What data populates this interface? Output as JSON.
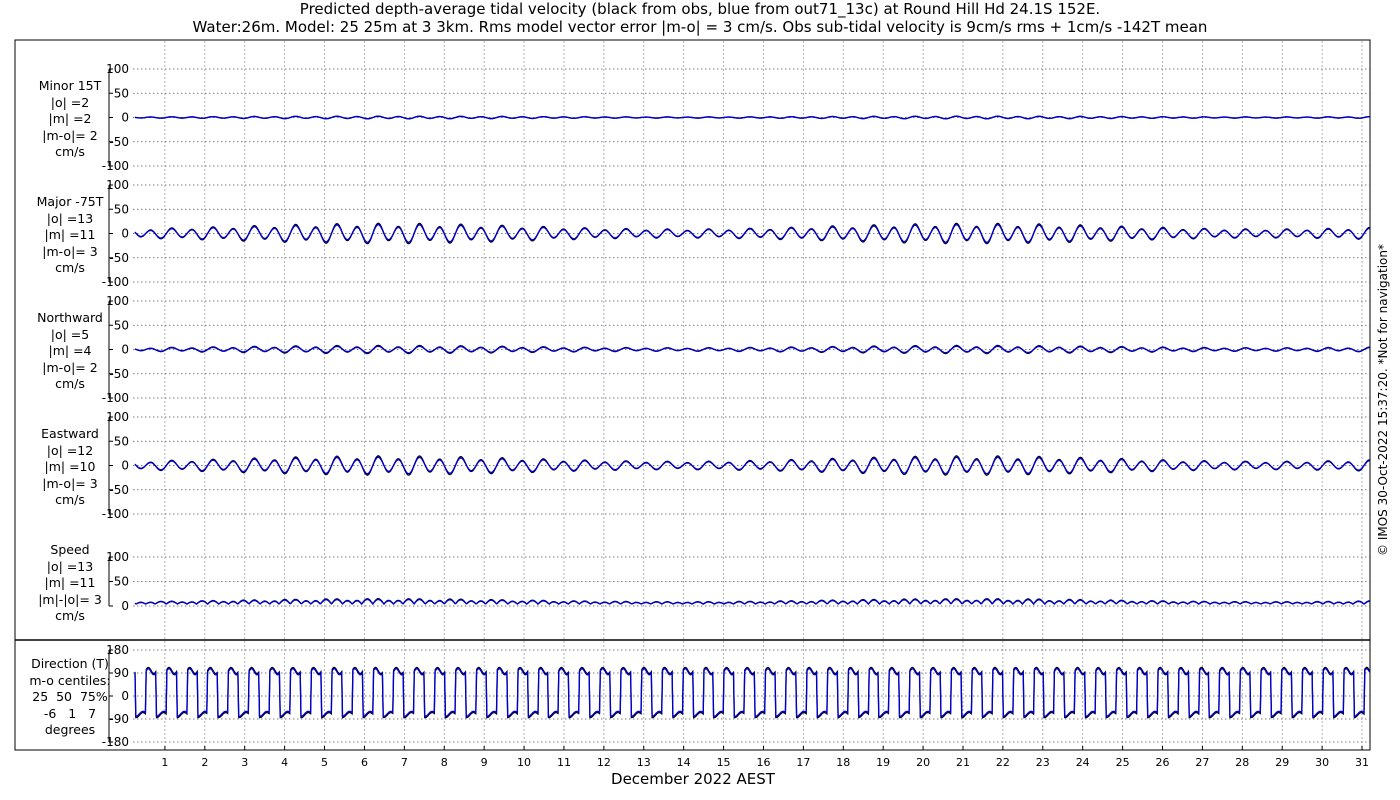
{
  "title_line1": "Predicted depth-average tidal velocity (black from obs, blue from out71_13c) at Round Hill Hd 24.1S 152E.",
  "title_line2": "Water:26m. Model: 25 25m at 3 3km. Rms model vector error |m-o| = 3 cm/s. Obs sub-tidal velocity is 9cm/s rms + 1cm/s -142T mean",
  "stamp": "© IMOS 30-Oct-2022 15:37:20. *Not for navigation*",
  "colors": {
    "obs": "#000000",
    "model": "#0000cc",
    "grid": "#9aa0b4"
  },
  "chart_data": [
    {
      "type": "line",
      "panel": "minor",
      "label_lines": [
        "Minor 15T",
        "|o| =2",
        "|m| =2",
        "|m-o|= 2",
        "cm/s"
      ],
      "ylim": [
        -100,
        100
      ],
      "yticks": [
        -100,
        -50,
        0,
        50,
        100
      ],
      "ytick_labels": [
        "-100",
        "-50",
        "0",
        "50",
        "100"
      ],
      "xlim": [
        0.2,
        31.2
      ],
      "grid": "dotted",
      "series": [
        {
          "role": "obs",
          "kind": "tidal",
          "amplitude": 2.5,
          "diurnal": 0.2,
          "offset": 0
        },
        {
          "role": "model",
          "kind": "tidal",
          "amplitude": 2.2,
          "diurnal": 0.2,
          "offset": 0
        }
      ]
    },
    {
      "type": "line",
      "panel": "major",
      "label_lines": [
        "Major -75T",
        "|o| =13",
        "|m| =11",
        "|m-o|= 3",
        "cm/s"
      ],
      "ylim": [
        -100,
        100
      ],
      "yticks": [
        -100,
        -50,
        0,
        50,
        100
      ],
      "ytick_labels": [
        "-100",
        "-50",
        "0",
        "50",
        "100"
      ],
      "xlim": [
        0.2,
        31.2
      ],
      "grid": "dotted",
      "series": [
        {
          "role": "obs",
          "kind": "tidal",
          "amplitude": 18,
          "diurnal": 0.25,
          "offset": 0
        },
        {
          "role": "model",
          "kind": "tidal",
          "amplitude": 15.5,
          "diurnal": 0.25,
          "offset": 0
        }
      ]
    },
    {
      "type": "line",
      "panel": "northward",
      "label_lines": [
        "Northward",
        "|o| =5",
        "|m| =4",
        "|m-o|= 2",
        "cm/s"
      ],
      "ylim": [
        -100,
        100
      ],
      "yticks": [
        -100,
        -50,
        0,
        50,
        100
      ],
      "ytick_labels": [
        "-100",
        "-50",
        "0",
        "50",
        "100"
      ],
      "xlim": [
        0.2,
        31.2
      ],
      "grid": "dotted",
      "series": [
        {
          "role": "obs",
          "kind": "tidal",
          "amplitude": 7,
          "diurnal": 0.3,
          "offset": 0
        },
        {
          "role": "model",
          "kind": "tidal",
          "amplitude": 5.5,
          "diurnal": 0.3,
          "offset": 0
        }
      ]
    },
    {
      "type": "line",
      "panel": "eastward",
      "label_lines": [
        "Eastward",
        "|o| =12",
        "|m| =10",
        "|m-o|= 3",
        "cm/s"
      ],
      "ylim": [
        -100,
        100
      ],
      "yticks": [
        -100,
        -50,
        0,
        50,
        100
      ],
      "ytick_labels": [
        "-100",
        "-50",
        "0",
        "50",
        "100"
      ],
      "xlim": [
        0.2,
        31.2
      ],
      "grid": "dotted",
      "series": [
        {
          "role": "obs",
          "kind": "tidal",
          "amplitude": 17,
          "diurnal": 0.25,
          "offset": 0
        },
        {
          "role": "model",
          "kind": "tidal",
          "amplitude": 14.5,
          "diurnal": 0.25,
          "offset": 0
        }
      ]
    },
    {
      "type": "line",
      "panel": "speed",
      "label_lines": [
        "Speed",
        "|o| =13",
        "|m| =11",
        "|m|-|o|= 3",
        "cm/s"
      ],
      "ylim": [
        0,
        100
      ],
      "yticks": [
        0,
        50,
        100
      ],
      "ytick_labels": [
        "0",
        "50",
        "100"
      ],
      "xlim": [
        0.2,
        31.2
      ],
      "grid": "dotted",
      "series": [
        {
          "role": "obs",
          "kind": "speed",
          "amplitude": 17,
          "diurnal": 0.25,
          "offset": 0
        },
        {
          "role": "model",
          "kind": "speed",
          "amplitude": 14.5,
          "diurnal": 0.25,
          "offset": 0
        }
      ]
    },
    {
      "type": "line",
      "panel": "direction",
      "label_lines": [
        "Direction (T)",
        "m-o centiles:",
        "25  50  75%",
        "-6   1   7",
        "degrees"
      ],
      "ylim": [
        -180,
        180
      ],
      "yticks": [
        -180,
        -90,
        0,
        90,
        180
      ],
      "ytick_labels": [
        "-180",
        "-90",
        "0",
        "90",
        "180"
      ],
      "xlim": [
        0.2,
        31.2
      ],
      "grid": "dotted",
      "series": [
        {
          "role": "obs",
          "kind": "direction",
          "high": 100,
          "low": -75
        },
        {
          "role": "model",
          "kind": "direction",
          "high": 95,
          "low": -70
        }
      ]
    }
  ],
  "xaxis": {
    "label": "December 2022 AEST",
    "ticks": [
      1,
      2,
      3,
      4,
      5,
      6,
      7,
      8,
      9,
      10,
      11,
      12,
      13,
      14,
      15,
      16,
      17,
      18,
      19,
      20,
      21,
      22,
      23,
      24,
      25,
      26,
      27,
      28,
      29,
      30,
      31
    ],
    "tick_labels": [
      "1",
      "2",
      "3",
      "4",
      "5",
      "6",
      "7",
      "8",
      "9",
      "10",
      "11",
      "12",
      "13",
      "14",
      "15",
      "16",
      "17",
      "18",
      "19",
      "20",
      "21",
      "22",
      "23",
      "24",
      "25",
      "26",
      "27",
      "28",
      "29",
      "30",
      "31"
    ],
    "xlim": [
      0.2,
      31.2
    ]
  }
}
